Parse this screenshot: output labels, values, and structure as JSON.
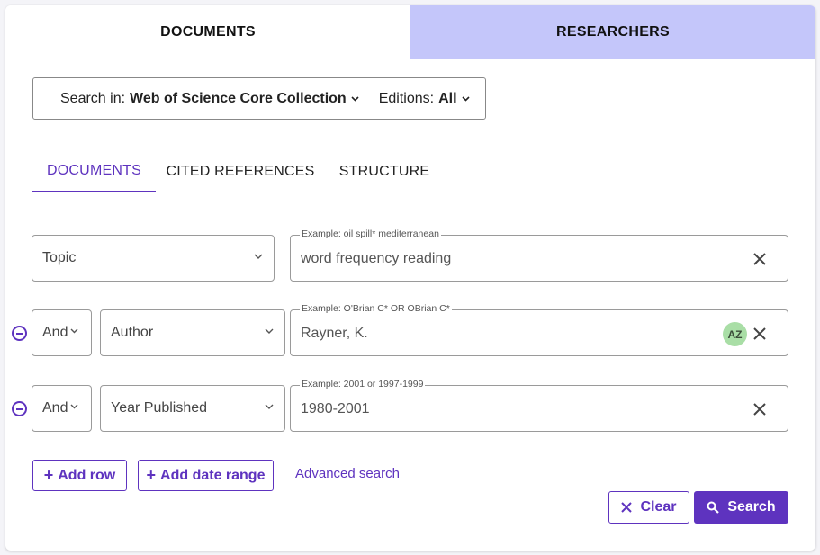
{
  "top_tabs": {
    "documents": "DOCUMENTS",
    "researchers": "RESEARCHERS"
  },
  "scope": {
    "search_in_label": "Search in:",
    "collection": "Web of Science Core Collection",
    "editions_label": "Editions:",
    "editions_value": "All"
  },
  "sub_tabs": {
    "documents": "DOCUMENTS",
    "cited_references": "CITED REFERENCES",
    "structure": "STRUCTURE"
  },
  "rows": [
    {
      "field": "Topic",
      "example": "Example: oil spill* mediterranean",
      "value": "word frequency reading"
    },
    {
      "operator": "And",
      "field": "Author",
      "example": "Example: O'Brian C* OR OBrian C*",
      "value": "Rayner, K.",
      "az_label": "AZ"
    },
    {
      "operator": "And",
      "field": "Year Published",
      "example": "Example: 2001 or 1997-1999",
      "value": "1980-2001"
    }
  ],
  "actions": {
    "add_row": "Add row",
    "add_date_range": "Add date range",
    "advanced_search": "Advanced search",
    "clear": "Clear",
    "search": "Search"
  },
  "colors": {
    "accent": "#5e33bf",
    "inactive_tab": "#c4c6fa",
    "az_badge": "#a9dea6"
  }
}
